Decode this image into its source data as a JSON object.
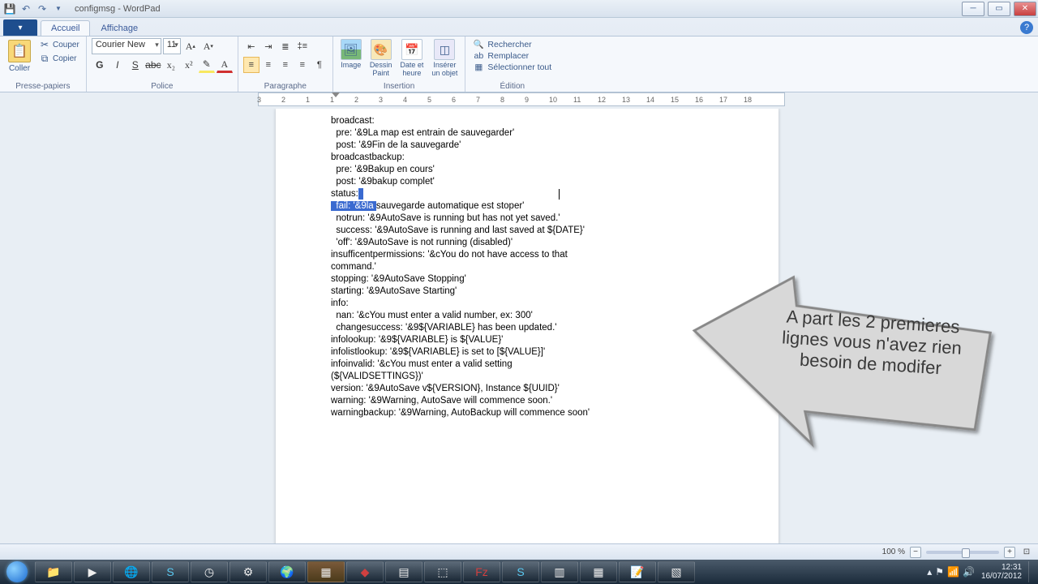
{
  "title": "configmsg - WordPad",
  "tabs": {
    "file": "▾",
    "accueil": "Accueil",
    "affichage": "Affichage"
  },
  "clipboard": {
    "coller": "Coller",
    "couper": "Couper",
    "copier": "Copier",
    "group": "Presse-papiers"
  },
  "font": {
    "name": "Courier New",
    "size": "11",
    "group": "Police"
  },
  "paragraph": {
    "group": "Paragraphe"
  },
  "insertion": {
    "image": "Image",
    "dessin": "Dessin",
    "paint": "Paint",
    "date": "Date et",
    "heure": "heure",
    "inserer": "Insérer",
    "objet": "un objet",
    "group": "Insertion"
  },
  "edition": {
    "rechercher": "Rechercher",
    "remplacer": "Remplacer",
    "selectionner": "Sélectionner tout",
    "group": "Édition"
  },
  "ruler_nums": [
    "3",
    "2",
    "1",
    "1",
    "2",
    "3",
    "4",
    "5",
    "6",
    "7",
    "8",
    "9",
    "10",
    "11",
    "12",
    "13",
    "14",
    "15",
    "16",
    "17",
    "18"
  ],
  "doc": {
    "l1": "broadcast:",
    "l2": "  pre: '&9La map est entrain de sauvegarder'",
    "l3": "  post: '&9Fin de la sauvegarde'",
    "l4": "broadcastbackup:",
    "l5": "  pre: '&9Bakup en cours'",
    "l6": "  post: '&9bakup complet'",
    "l7": "status:",
    "l8a": "  fail: '&9la ",
    "l8b": "sauvegarde automatique est stoper'",
    "l9": "  notrun: '&9AutoSave is running but has not yet saved.'",
    "l10": "  success: '&9AutoSave is running and last saved at ${DATE}'",
    "l11": "  'off': '&9AutoSave is not running (disabled)'",
    "l12": "insufficentpermissions: '&cYou do not have access to that",
    "l13": "command.'",
    "l14": "stopping: '&9AutoSave Stopping'",
    "l15": "starting: '&9AutoSave Starting'",
    "l16": "info:",
    "l17": "  nan: '&cYou must enter a valid number, ex: 300'",
    "l18": "  changesuccess: '&9${VARIABLE} has been updated.'",
    "l19": "infolookup: '&9${VARIABLE} is ${VALUE}'",
    "l20": "infolistlookup: '&9${VARIABLE} is set to [${VALUE}]'",
    "l21": "infoinvalid: '&cYou must enter a valid setting",
    "l22": "(${VALIDSETTINGS})'",
    "l23": "version: '&9AutoSave v${VERSION}, Instance ${UUID}'",
    "l24": "warning: '&9Warning, AutoSave will commence soon.'",
    "l25": "warningbackup: '&9Warning, AutoBackup will commence soon'"
  },
  "callout": "A part les  2 premieres lignes vous n'avez rien besoin de modifer",
  "status": {
    "zoom": "100 %"
  },
  "tray": {
    "time": "12:31",
    "date": "16/07/2012"
  }
}
